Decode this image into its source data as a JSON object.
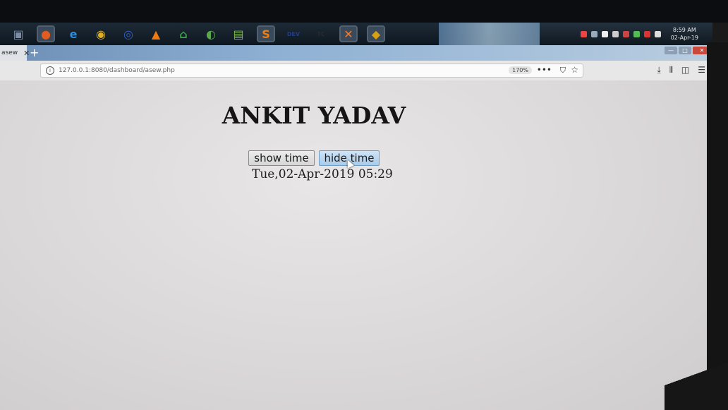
{
  "taskbar": {
    "apps": [
      {
        "name": "computer",
        "glyph": "▣",
        "color": "#7a8da4"
      },
      {
        "name": "firefox",
        "glyph": "●",
        "color": "#e25b1f"
      },
      {
        "name": "internet-explorer",
        "glyph": "e",
        "color": "#2b8fe0"
      },
      {
        "name": "chrome",
        "glyph": "◉",
        "color": "#e0b020"
      },
      {
        "name": "wifi",
        "glyph": "◎",
        "color": "#2d5fc8"
      },
      {
        "name": "vlc",
        "glyph": "▲",
        "color": "#f07a10"
      },
      {
        "name": "home",
        "glyph": "⌂",
        "color": "#3aa04a"
      },
      {
        "name": "app-green",
        "glyph": "◐",
        "color": "#5aa84a"
      },
      {
        "name": "notepad",
        "glyph": "▤",
        "color": "#7fb84f"
      },
      {
        "name": "sublime",
        "glyph": "S",
        "color": "#f07d10"
      },
      {
        "name": "dev-cpp",
        "glyph": "DEV",
        "color": "#1f3c8a"
      },
      {
        "name": "turbo-c",
        "glyph": "TC",
        "color": "#2a2a2a"
      },
      {
        "name": "xampp",
        "glyph": "✕",
        "color": "#fb7a24"
      },
      {
        "name": "media",
        "glyph": "◆",
        "color": "#d6a012"
      }
    ],
    "clock_time": "8:59 AM",
    "clock_date": "02-Apr-19"
  },
  "browser": {
    "tab_title": "asew",
    "tab_close": "✕",
    "new_tab": "+",
    "url": "127.0.0.1:8080/dashboard/asew.php",
    "zoom": "170%",
    "window_controls": {
      "minimize": "—",
      "maximize": "□",
      "close": "✕"
    }
  },
  "page": {
    "heading": "ANKIT YADAV",
    "show_button": "show time",
    "hide_button": "hide time",
    "timestamp": "Tue,02-Apr-2019 05:29"
  }
}
